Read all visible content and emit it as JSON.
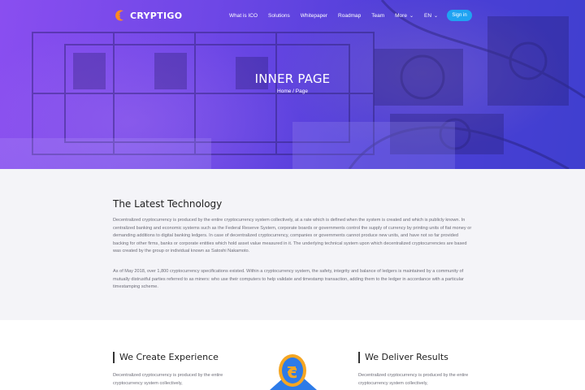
{
  "brand": {
    "name": "CRYPTIGO",
    "accent": "#ff8a1f",
    "button_color": "#1fa3f2",
    "hero_colors": [
      "#8a4ef0",
      "#3f3fcf"
    ]
  },
  "nav": {
    "items": [
      "What is ICO",
      "Solutions",
      "Whitepaper",
      "Roadmap",
      "Team",
      "More"
    ],
    "language": "EN",
    "signin": "Sign in"
  },
  "hero": {
    "title": "INNER PAGE",
    "breadcrumb_home": "Home",
    "breadcrumb_sep": "/",
    "breadcrumb_current": "Page"
  },
  "tech": {
    "heading": "The Latest Technology",
    "p1": "Decentralized cryptocurrency is produced by the entire cryptocurrency system collectively, at a rate which is defined when the system is created and which is publicly known. In centralized banking and economic systems such as the Federal Reserve System, corporate boards or governments control the supply of currency by printing units of fiat money or demanding additions to digital banking ledgers. In case of decentralized cryptocurrency, companies or governments cannot produce new units, and have not so far provided backing for other firms, banks or corporate entities which hold asset value measured in it. The underlying technical system upon which decentralized cryptocurrencies are based was created by the group or individual known as Satoshi Nakamoto.",
    "p2": "As of May 2018, over 1,800 cryptocurrency specifications existed. Within a cryptocurrency system, the safety, integrity and balance of ledgers is maintained by a community of mutually distrustful parties referred to as miners: who use their computers to help validate and timestamp transaction, adding them to the ledger in accordance with a particular timestamping scheme."
  },
  "features": [
    {
      "title": "We Create Experience",
      "text": "Decentralized cryptocurrency is produced by the entire cryptocurrency system collectively,"
    },
    {
      "title": "We Deliver Results",
      "text": "Decentralized cryptocurrency is produced by the entire cryptocurrency system collectively,"
    }
  ],
  "icons": {
    "chevron": "chevron-down-icon",
    "logo": "crescent-logo-icon",
    "coin": "coin-illustration"
  }
}
